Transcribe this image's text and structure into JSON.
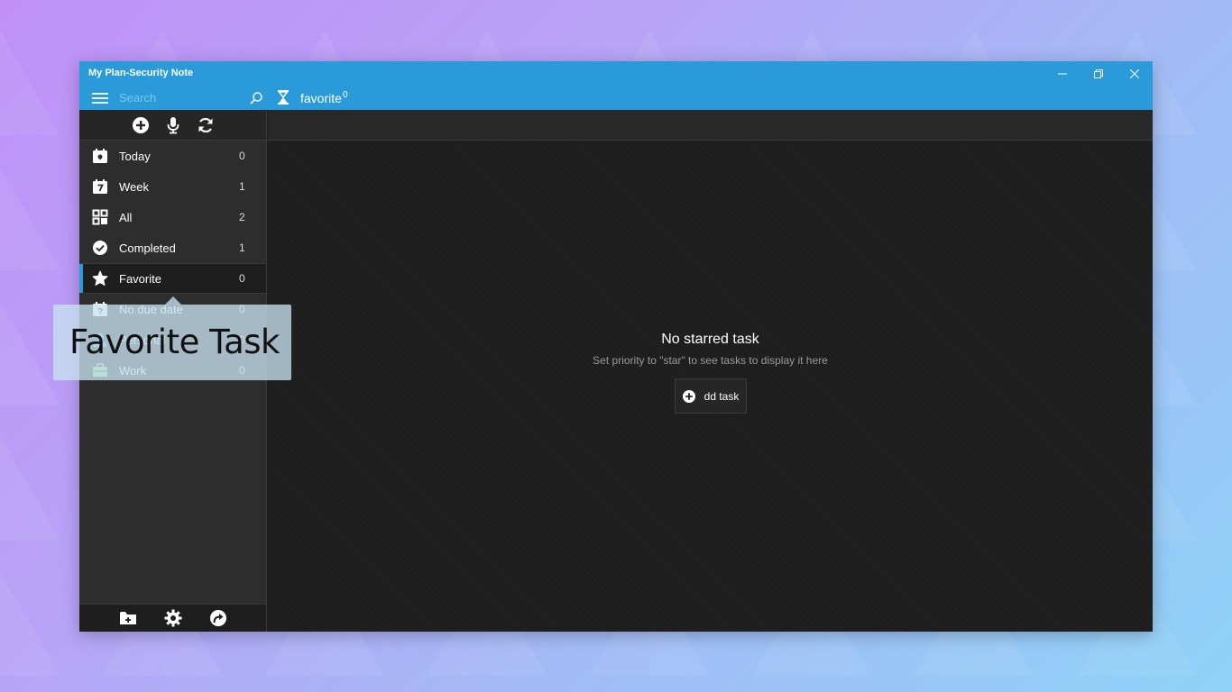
{
  "window": {
    "title": "My Plan-Security Note",
    "controls": {
      "minimize": "—",
      "restore": "❐",
      "close": "✕"
    }
  },
  "header": {
    "search_placeholder": "Search",
    "view_title": "favorite",
    "view_count": "0"
  },
  "toolbar": {
    "icons": [
      "add-icon",
      "microphone-icon",
      "sync-icon"
    ]
  },
  "sidebar": {
    "items": [
      {
        "label": "Today",
        "count": "0",
        "icon": "calendar-today-icon"
      },
      {
        "label": "Week",
        "count": "1",
        "icon": "calendar-week-icon"
      },
      {
        "label": "All",
        "count": "2",
        "icon": "grid-icon"
      },
      {
        "label": "Completed",
        "count": "1",
        "icon": "check-circle-icon"
      },
      {
        "label": "Favorite",
        "count": "0",
        "icon": "star-icon",
        "active": true
      },
      {
        "label": "No due date",
        "count": "0",
        "icon": "calendar-question-icon"
      },
      {
        "label": "Personal",
        "count": "0",
        "icon": "person-icon"
      },
      {
        "label": "Work",
        "count": "0",
        "icon": "briefcase-icon"
      }
    ],
    "footer_icons": [
      "add-folder-icon",
      "settings-icon",
      "share-icon"
    ]
  },
  "main": {
    "empty_title": "No starred task",
    "empty_subtitle": "Set priority to \"star\" to see tasks to display it here",
    "add_task_label": "dd task"
  },
  "tooltip": {
    "text": "Favorite Task"
  },
  "colors": {
    "accent": "#2a9bd8",
    "sidebar_bg": "#2d2d2d",
    "main_bg": "#1d1d1d"
  }
}
